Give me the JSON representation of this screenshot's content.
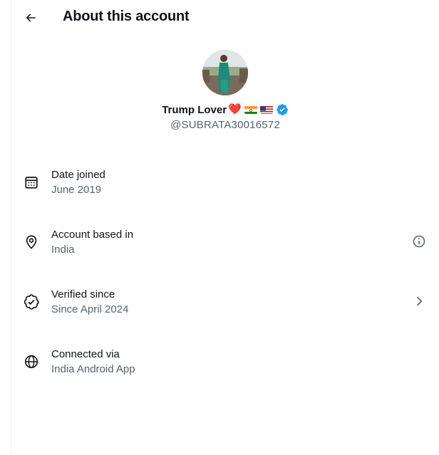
{
  "header": {
    "title": "About this account"
  },
  "profile": {
    "name": "Trump Lover",
    "name_emoji": "❤️",
    "handle": "@SUBRATA30016572"
  },
  "rows": [
    {
      "label": "Date joined",
      "value": "June 2019",
      "icon": "calendar-icon"
    },
    {
      "label": "Account based in",
      "value": "India",
      "icon": "location-pin-icon",
      "trailing": "info-icon"
    },
    {
      "label": "Verified since",
      "value": "Since April 2024",
      "icon": "verified-badge-outline-icon",
      "trailing": "chevron-right-icon"
    },
    {
      "label": "Connected via",
      "value": "India Android App",
      "icon": "globe-icon"
    }
  ],
  "colors": {
    "text": "#0f1419",
    "secondary": "#536471",
    "verified": "#1d9bf0",
    "heart": "#e0245e"
  }
}
